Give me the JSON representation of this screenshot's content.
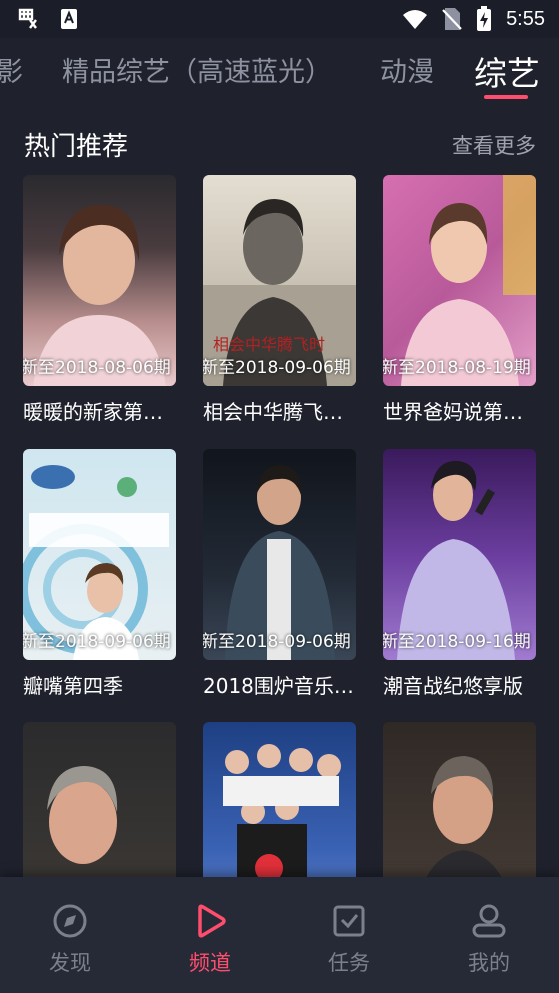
{
  "status_bar": {
    "time": "5:55"
  },
  "tabs": [
    {
      "label": "影"
    },
    {
      "label": "精品综艺（高速蓝光）"
    },
    {
      "label": "动漫"
    },
    {
      "label": "综艺",
      "active": true
    }
  ],
  "section": {
    "title": "热门推荐",
    "more": "查看更多"
  },
  "cards": [
    {
      "caption": "新至2018-08-06期",
      "title": "暖暖的新家第…",
      "bg": "#8a6f73"
    },
    {
      "caption": "新至2018-09-06期",
      "title": "相会中华腾飞…",
      "bg": "#d9d2c4"
    },
    {
      "caption": "新至2018-08-19期",
      "title": "世界爸妈说第…",
      "bg": "#c86aa5"
    },
    {
      "caption": "新至2018-09-06期",
      "title": "瓣嘴第四季",
      "bg": "#dde7ee"
    },
    {
      "caption": "新至2018-09-06期",
      "title": "2018围炉音乐…",
      "bg": "#2e3644"
    },
    {
      "caption": "新至2018-09-16期",
      "title": "潮音战纪悠享版",
      "bg": "#6b49a8"
    },
    {
      "caption": "",
      "title": "",
      "bg": "#3a3a3c"
    },
    {
      "caption": "",
      "title": "",
      "bg": "#2f4e8c"
    },
    {
      "caption": "",
      "title": "",
      "bg": "#3b3330"
    }
  ],
  "bottom_nav": [
    {
      "label": "发现",
      "icon": "compass-icon"
    },
    {
      "label": "频道",
      "icon": "play-icon",
      "active": true
    },
    {
      "label": "任务",
      "icon": "task-icon"
    },
    {
      "label": "我的",
      "icon": "user-icon"
    }
  ],
  "colors": {
    "accent": "#ff4d6d",
    "background": "#1f222d",
    "nav_bg": "#262a36"
  }
}
